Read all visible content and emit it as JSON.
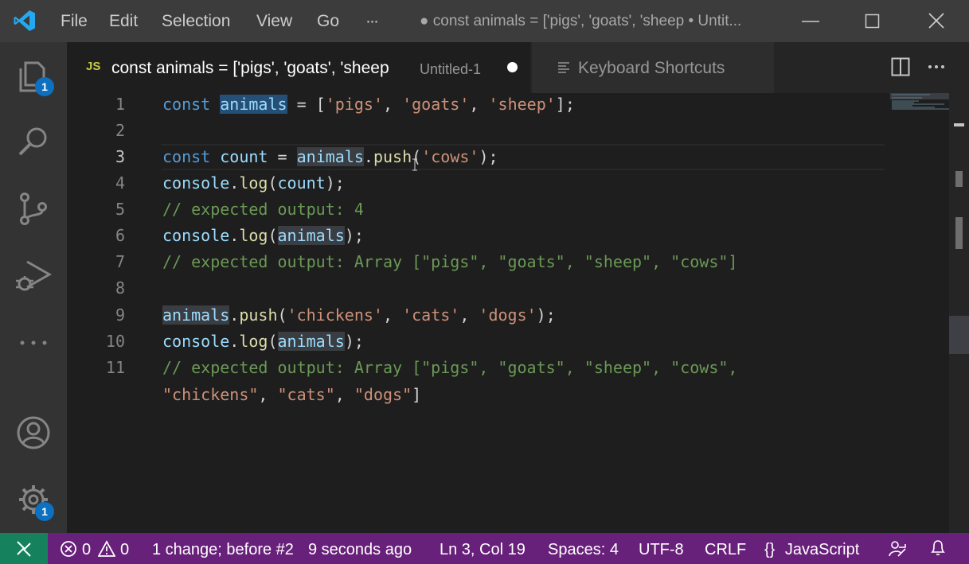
{
  "titlebar": {
    "menu": [
      "File",
      "Edit",
      "Selection",
      "View",
      "Go",
      "···"
    ],
    "window_title": "● const animals = ['pigs', 'goats', 'sheep • Untit..."
  },
  "activity_badges": {
    "explorer": "1",
    "settings": "1"
  },
  "tabs": [
    {
      "icon": "JS",
      "label": "const animals = ['pigs', 'goats', 'sheep",
      "description": "Untitled-1"
    },
    {
      "label": "Keyboard Shortcuts"
    }
  ],
  "editor": {
    "line_numbers": [
      "1",
      "2",
      "3",
      "4",
      "5",
      "6",
      "7",
      "8",
      "9",
      "10",
      "11"
    ],
    "lines": [
      "const animals = ['pigs', 'goats', 'sheep'];",
      "",
      "const count = animals.push('cows');",
      "console.log(count);",
      "// expected output: 4",
      "console.log(animals);",
      "// expected output: Array [\"pigs\", \"goats\", \"sheep\", \"cows\"]",
      "",
      "animals.push('chickens', 'cats', 'dogs');",
      "console.log(animals);",
      "// expected output: Array [\"pigs\", \"goats\", \"sheep\", \"cows\",",
      "\"chickens\", \"cats\", \"dogs\"]"
    ],
    "active_line": 3
  },
  "statusbar": {
    "errors": "0",
    "warnings": "0",
    "change_info": "1 change; before #2",
    "time_ago": "9 seconds ago",
    "position": "Ln 3, Col 19",
    "indent": "Spaces: 4",
    "encoding": "UTF-8",
    "eol": "CRLF",
    "language_icon": "{}",
    "language": "JavaScript"
  },
  "colors": {
    "titlebar_bg": "#3c3c3c",
    "activitybar_bg": "#333333",
    "editor_bg": "#1e1e1e",
    "statusbar_bg": "#68217a",
    "remote_bg": "#16825d",
    "badge_bg": "#0e70c0",
    "keyword": "#569cd6",
    "variable": "#9cdcfe",
    "string": "#ce9178",
    "function": "#dcdcaa",
    "comment": "#6a9955"
  },
  "icons": [
    "vscode-logo-icon",
    "explorer-icon",
    "search-icon",
    "source-control-icon",
    "run-debug-icon",
    "more-icon",
    "account-icon",
    "manage-gear-icon",
    "split-editor-icon",
    "more-actions-icon",
    "keyboard-icon",
    "minimize-icon",
    "maximize-icon",
    "close-icon",
    "remote-icon",
    "error-icon",
    "warning-icon",
    "feedback-icon",
    "bell-icon"
  ]
}
